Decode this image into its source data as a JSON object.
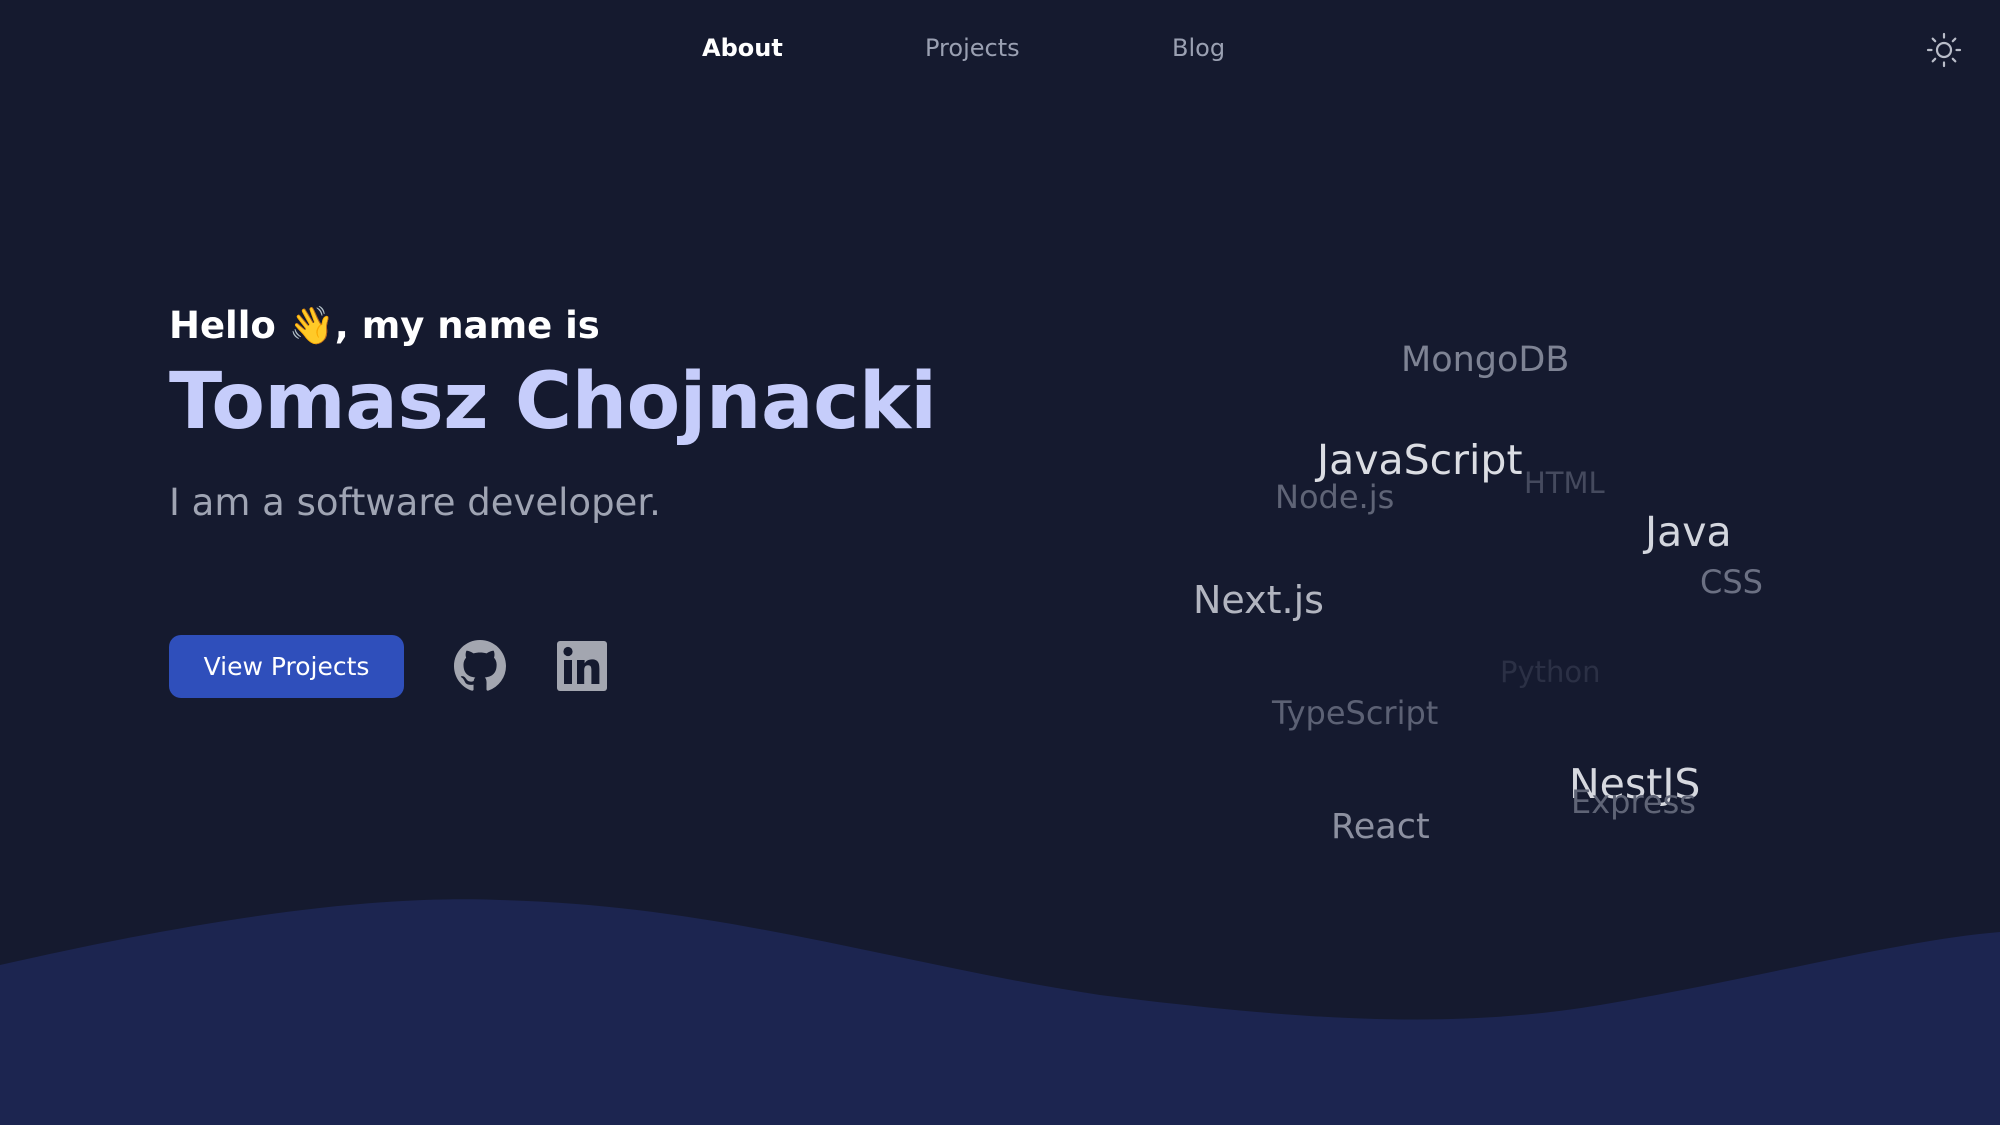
{
  "nav": {
    "items": [
      {
        "label": "About",
        "active": true
      },
      {
        "label": "Projects",
        "active": false
      },
      {
        "label": "Blog",
        "active": false
      }
    ],
    "theme_toggle_icon": "sun-icon"
  },
  "hero": {
    "greeting": "Hello 👋, my name is",
    "name": "Tomasz Chojnacki",
    "tagline": "I am a software developer.",
    "cta_label": "View Projects",
    "social": [
      {
        "icon": "github-icon"
      },
      {
        "icon": "linkedin-icon"
      }
    ]
  },
  "tag_cloud": {
    "tags": [
      "MongoDB",
      "JavaScript",
      "HTML",
      "Node.js",
      "Java",
      "CSS",
      "Next.js",
      "Python",
      "TypeScript",
      "NestJS",
      "Express",
      "React"
    ]
  },
  "colors": {
    "background": "#151a2f",
    "wave": "#1c2550",
    "accent_button": "#2f4fbb",
    "name": "#c6cdfb"
  }
}
